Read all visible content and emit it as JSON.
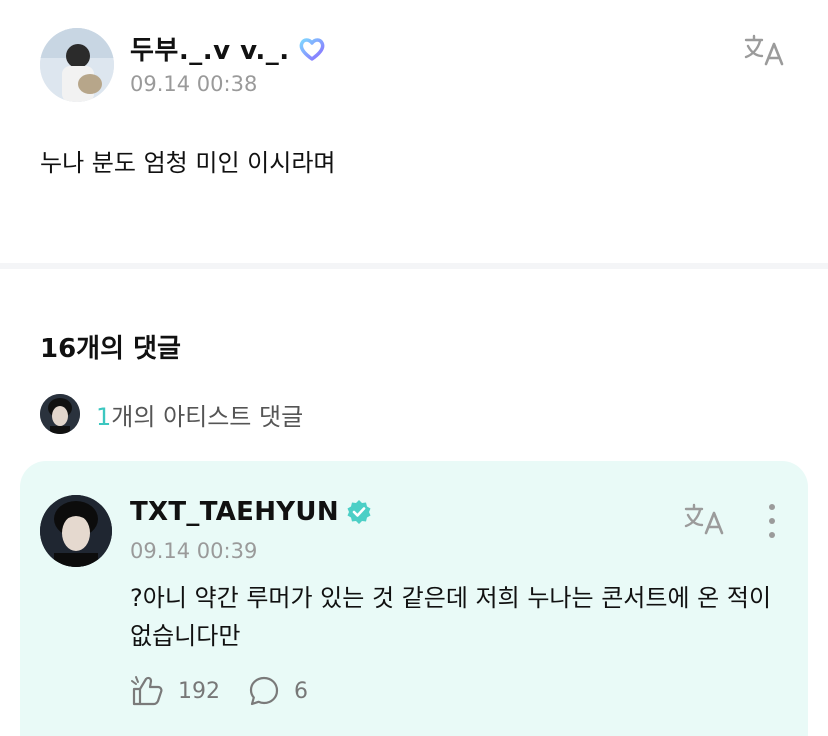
{
  "post": {
    "author_name": "두부._.v  v._.",
    "time": "09.14 00:38",
    "body": "누나 분도 엄청 미인 이시라며"
  },
  "comments": {
    "count_label": "16개의 댓글",
    "artist_count_num": "1",
    "artist_count_text": "개의 아티스트 댓글"
  },
  "artist_comment": {
    "name": "TXT_TAEHYUN",
    "time": "09.14 00:39",
    "text": "?아니 약간 루머가 있는 것 같은데 저희 누나는 콘서트에 온 적이 없습니다만",
    "likes": "192",
    "replies": "6"
  },
  "colors": {
    "accent": "#3cc7c0",
    "card_background": "#e9faf7",
    "muted_text": "#9a9a9a"
  },
  "icons": [
    "heart-badge-icon",
    "translate-icon",
    "verified-icon",
    "more-vertical-icon",
    "like-icon",
    "comment-icon"
  ]
}
